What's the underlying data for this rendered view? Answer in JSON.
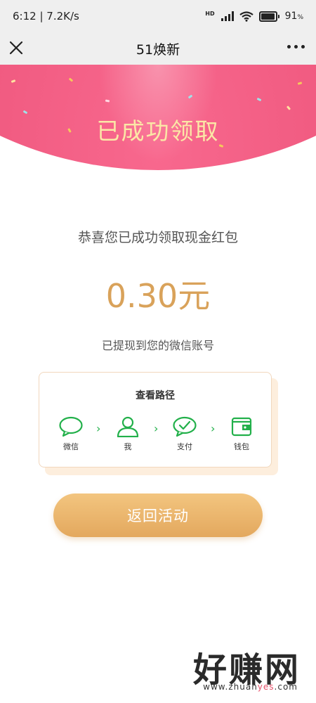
{
  "status_bar": {
    "time": "6:12",
    "network_speed": "7.2K/s",
    "hd_label": "HD",
    "battery_percent": "91",
    "battery_unit": "%"
  },
  "nav": {
    "title": "51焕新",
    "close_icon": "close-icon",
    "more_icon": "more-icon"
  },
  "header": {
    "title": "已成功领取",
    "colors": {
      "background": "#ec4e75",
      "title": "#fbe7a6"
    }
  },
  "result": {
    "congrats_text": "恭喜您已成功领取现金红包",
    "amount": "0.30元",
    "withdraw_note": "已提现到您的微信账号",
    "amount_color": "#d9a25a"
  },
  "path_card": {
    "title": "查看路径",
    "steps": [
      {
        "label": "微信",
        "icon": "chat-bubble-icon"
      },
      {
        "label": "我",
        "icon": "person-icon"
      },
      {
        "label": "支付",
        "icon": "check-circle-icon"
      },
      {
        "label": "钱包",
        "icon": "wallet-icon"
      }
    ],
    "separator": "›",
    "icon_color": "#22b04a"
  },
  "back_button": {
    "label": "返回活动",
    "color": "#e8ac62"
  },
  "watermark": {
    "title": "好赚网",
    "url_prefix": "www.zhuan",
    "url_highlight": "yes",
    "url_suffix": ".com"
  }
}
